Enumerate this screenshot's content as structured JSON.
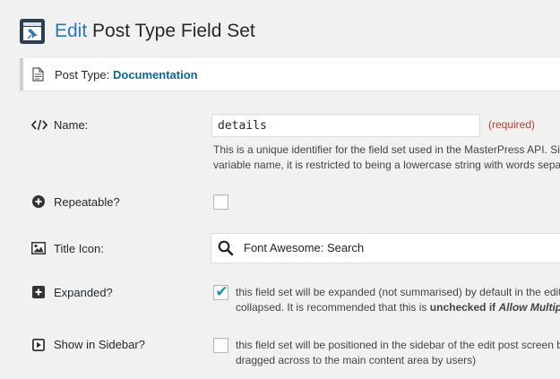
{
  "header": {
    "title_accent": "Edit",
    "title_rest": "Post Type Field Set",
    "icon": "pin-icon"
  },
  "post_type_bar": {
    "label": "Post Type:",
    "value": "Documentation",
    "icon": "document-icon"
  },
  "fields": {
    "name": {
      "icon": "code-icon",
      "label": "Name:",
      "value": "details",
      "required": "(required)",
      "description_line1": "This is a unique identifier for the field set used in the MasterPress API. Since",
      "description_line2": "variable name, it is restricted to being a lowercase string with words separat"
    },
    "repeatable": {
      "icon": "plus-circle-icon",
      "label": "Repeatable?",
      "checked": false
    },
    "title_icon": {
      "icon": "image-icon",
      "label": "Title Icon:",
      "value": "Font Awesome: Search",
      "value_icon": "search-icon"
    },
    "expanded": {
      "icon": "plus-square-icon",
      "label": "Expanded?",
      "checked": true,
      "description_line1": "this field set will be expanded (not summarised) by default in the edit p",
      "description_line2_prefix": "collapsed. It is recommended that this is ",
      "description_line2_bold": "unchecked",
      "description_line2_bold2": " if ",
      "description_line2_italic": "Allow Multiple It"
    },
    "sidebar": {
      "icon": "play-square-icon",
      "label": "Show in Sidebar?",
      "checked": false,
      "description_line1": "this field set will be positioned in the sidebar of the edit post screen by",
      "description_line2": "dragged across to the main content area by users)"
    }
  }
}
